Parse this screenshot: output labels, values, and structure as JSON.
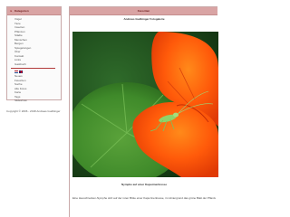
{
  "sidebar": {
    "title": "Kategorien",
    "items": [
      {
        "label": "Vögel"
      },
      {
        "label": "Tiere"
      },
      {
        "label": "Insecten"
      },
      {
        "label": "Pflanzen"
      },
      {
        "label": "Städte"
      },
      {
        "label": "Menschen"
      },
      {
        "label": "Bergen"
      },
      {
        "label": "Spiegelungen"
      }
    ],
    "menu": [
      {
        "label": "Über"
      },
      {
        "label": "Kontakt"
      },
      {
        "label": "Links"
      },
      {
        "label": "Gastbuch"
      }
    ],
    "links": [
      {
        "label": "Neues"
      },
      {
        "label": "Favoriten"
      },
      {
        "label": "Suche"
      },
      {
        "label": "Alle Fotos"
      },
      {
        "label": "Karte"
      },
      {
        "label": "Tags"
      },
      {
        "label": "Slideshow"
      }
    ],
    "languages": [
      "Nederlands",
      "English"
    ]
  },
  "copyright": "Copyright © 2006 - 2018 Andreas Gudbinger",
  "main": {
    "header": "Favoriten",
    "photo_title": "Andreas Gudbinger Fotogalerie",
    "caption": "Nymphe auf einer Kapuzinerkresse",
    "description": "Eine Heuschrecken-Nymphe sitzt auf der roten Blüte einer Kapuzinerkresse, im Hintergrund das grüne Blatt der Pflanze."
  },
  "colors": {
    "header_bg": "#d9a4a4",
    "accent": "#b23a3a",
    "border": "#c9a9a9"
  }
}
